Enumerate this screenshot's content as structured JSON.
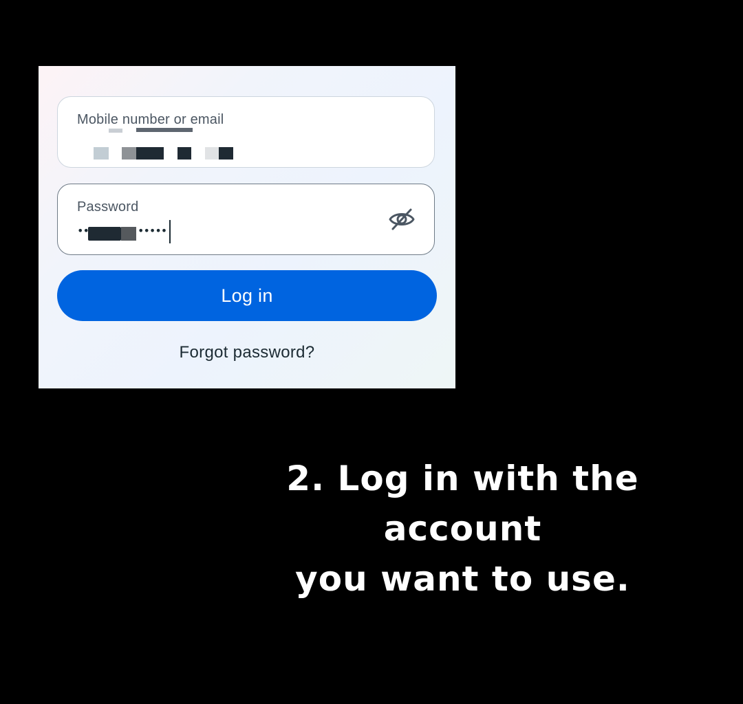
{
  "login_form": {
    "email_field": {
      "label": "Mobile number or email",
      "value": "[redacted]"
    },
    "password_field": {
      "label": "Password",
      "value": "[redacted]",
      "dots_lead": "••",
      "dots_trail": "•••••",
      "visibility_icon": "eye-off-icon"
    },
    "login_button_label": "Log in",
    "forgot_password_label": "Forgot password?"
  },
  "caption": {
    "line1": "2. Log in with the account",
    "line2": "you want to use."
  },
  "colors": {
    "background": "#000000",
    "primary_button": "#0064e0",
    "text_dark": "#1c2b33"
  }
}
